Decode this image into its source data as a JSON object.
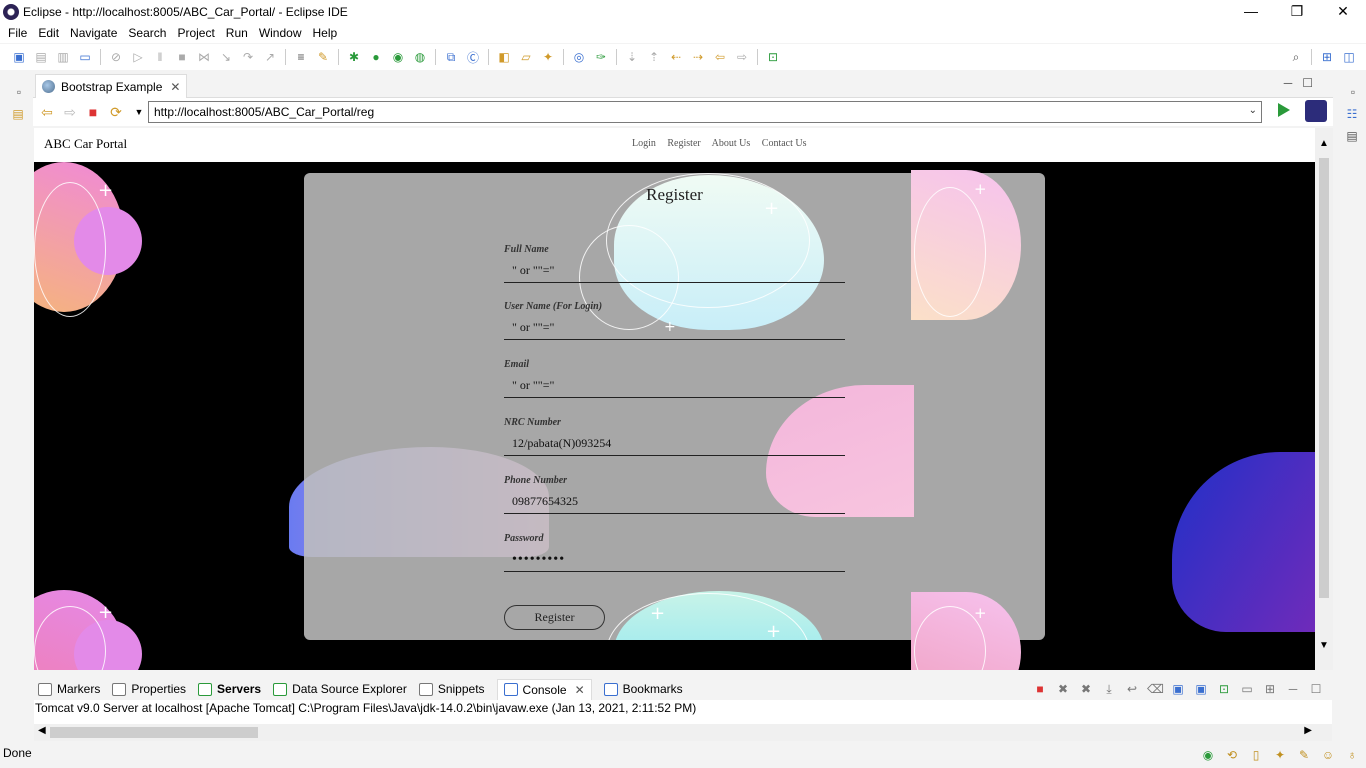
{
  "window": {
    "title": "Eclipse - http://localhost:8005/ABC_Car_Portal/ - Eclipse IDE",
    "min": "—",
    "max": "❐",
    "close": "✕"
  },
  "menu": [
    "File",
    "Edit",
    "Navigate",
    "Search",
    "Project",
    "Run",
    "Window",
    "Help"
  ],
  "editor_tab": {
    "label": "Bootstrap Example",
    "close": "✕"
  },
  "browser": {
    "url": "http://localhost:8005/ABC_Car_Portal/reg"
  },
  "site": {
    "brand": "ABC Car Portal",
    "nav": [
      "Login",
      "Register",
      "About Us",
      "Contact Us"
    ],
    "form": {
      "title": "Register",
      "fields": [
        {
          "label": "Full Name",
          "value": "\" or \"\"=\""
        },
        {
          "label": "User Name (For Login)",
          "value": "\" or \"\"=\""
        },
        {
          "label": "Email",
          "value": "\" or \"\"=\""
        },
        {
          "label": "NRC Number",
          "value": "12/pabata(N)093254"
        },
        {
          "label": "Phone Number",
          "value": "09877654325"
        },
        {
          "label": "Password",
          "value": "•••••••••"
        }
      ],
      "submit": "Register"
    }
  },
  "bottom_panel": {
    "tabs": [
      "Markers",
      "Properties",
      "Servers",
      "Data Source Explorer",
      "Snippets",
      "Console",
      "Bookmarks"
    ],
    "console_line": "Tomcat v9.0 Server at localhost [Apache Tomcat] C:\\Program Files\\Java\\jdk-14.0.2\\bin\\javaw.exe  (Jan 13, 2021, 2:11:52 PM)"
  },
  "status": {
    "text": "Done"
  },
  "colors": {
    "accent_green": "#2a9a3a",
    "card_bg": "#bebebe",
    "hero_bg": "#000000"
  }
}
